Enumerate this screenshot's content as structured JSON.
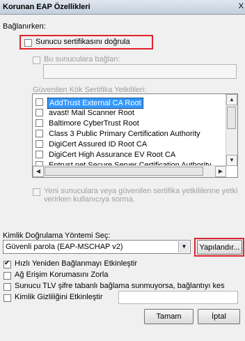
{
  "window": {
    "title": "Korunan EAP Özellikleri",
    "close_glyph": "X"
  },
  "connecting": {
    "group_label": "Bağlanırken:",
    "verify_cert_label": "Sunucu sertifikasını doğrula",
    "connect_servers_label": "Bu sunuculara bağlan:",
    "connect_servers_value": ""
  },
  "trusted_roots": {
    "label": "Güvenilen Kök Sertifika Yetkilileri:",
    "items": [
      {
        "label": "AddTrust External CA Root",
        "selected": true
      },
      {
        "label": "avast! Mail Scanner Root"
      },
      {
        "label": "Baltimore CyberTrust Root"
      },
      {
        "label": "Class 3 Public Primary Certification Authority"
      },
      {
        "label": "DigiCert Assured ID Root CA"
      },
      {
        "label": "DigiCert High Assurance EV Root CA"
      },
      {
        "label": "Entrust.net Secure Server Certification Authority"
      }
    ]
  },
  "no_prompt": {
    "line1": "Yeni sunuculara veya güvenilen sertifika yetkililerine yetki",
    "line2": "verirken kullanıcıya sorma."
  },
  "auth": {
    "label": "Kimlik Doğrulama Yöntemi Seç:",
    "method_value": "Güvenli parola (EAP-MSCHAP v2)",
    "configure_button": "Yapılandır..."
  },
  "options": {
    "fast_reconnect": "Hızlı Yeniden Bağlanmayı Etkinleştir",
    "nap": "Ağ Erişim Korumasını Zorla",
    "tlv": "Sunucu TLV şifre tabanlı bağlama sunmuyorsa, bağlantıyı kes",
    "identity_privacy": "Kimlik Gizliliğini Etkinleştir",
    "identity_value": ""
  },
  "footer": {
    "ok": "Tamam",
    "cancel": "İptal"
  },
  "colors": {
    "highlight": "#e0232b",
    "selection": "#3399ff"
  }
}
